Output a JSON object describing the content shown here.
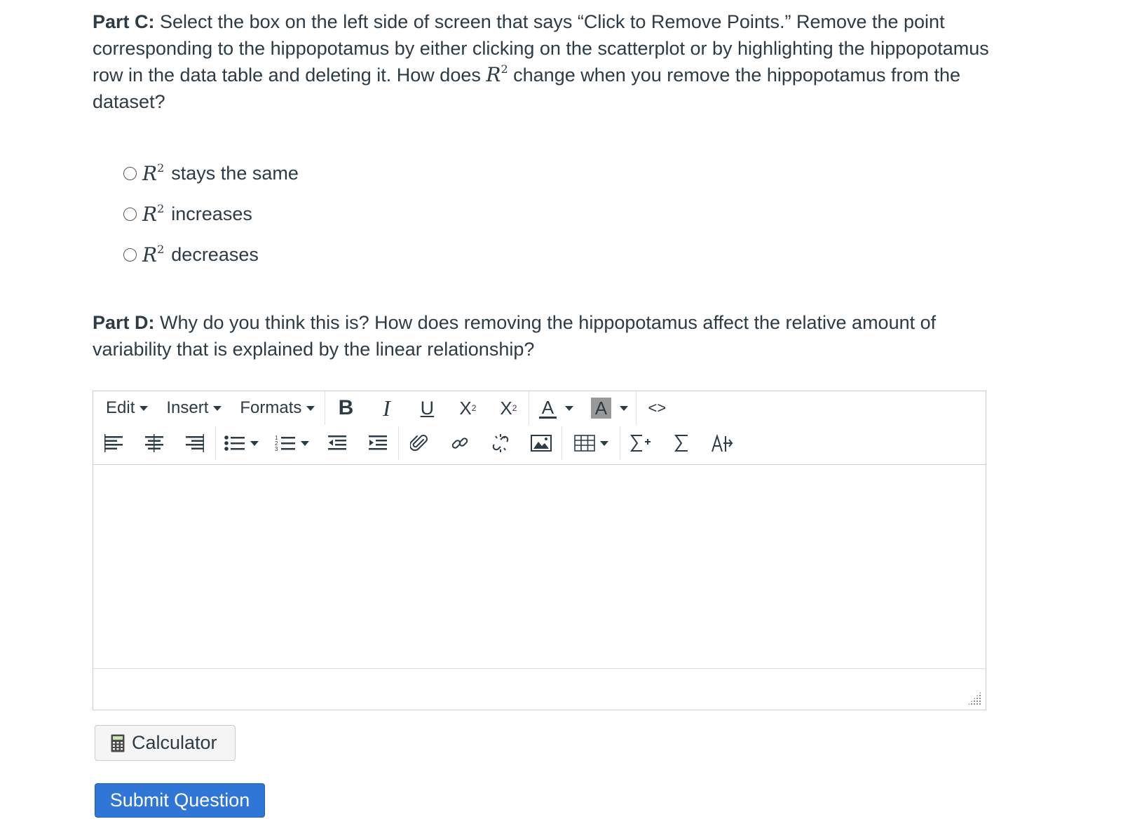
{
  "part_c": {
    "label": "Part C:",
    "text_1": " Select the box on the left side of screen that says “Click to Remove Points.” Remove the point corresponding to the hippopotamus by either clicking on the scatterplot or by highlighting the hippopotamus row in the data table and deleting it. How does ",
    "math_symbol": "R",
    "math_exponent": "2",
    "text_2": " change when you remove the hippopotamus from the dataset?"
  },
  "choices": [
    {
      "symbol": "R",
      "exponent": "2",
      "label": "stays the same",
      "selected": false
    },
    {
      "symbol": "R",
      "exponent": "2",
      "label": "increases",
      "selected": false
    },
    {
      "symbol": "R",
      "exponent": "2",
      "label": "decreases",
      "selected": false
    }
  ],
  "part_d": {
    "label": "Part D:",
    "text": " Why do you think this is? How does removing the hippopotamus affect the relative amount of variability that is explained by the linear relationship?"
  },
  "editor": {
    "menus": {
      "edit": "Edit",
      "insert": "Insert",
      "formats": "Formats"
    },
    "format_buttons": {
      "bold": "B",
      "italic": "I",
      "underline": "U",
      "subscript": "X",
      "subscript_mark": "2",
      "superscript": "X",
      "superscript_mark": "2",
      "text_color": "A",
      "background_color": "A",
      "code": "<>"
    },
    "icons": [
      "align-left-icon",
      "align-center-icon",
      "align-right-icon",
      "bullet-list-icon",
      "numbered-list-icon",
      "outdent-icon",
      "indent-icon",
      "attachment-icon",
      "link-icon",
      "unlink-icon",
      "image-icon",
      "table-icon",
      "equation-insert-icon",
      "sigma-icon",
      "text-direction-icon"
    ],
    "content": ""
  },
  "calculator": {
    "label": "Calculator",
    "icon": "calculator-icon"
  },
  "submit": {
    "label": "Submit Question",
    "color": "#2f76d6"
  }
}
